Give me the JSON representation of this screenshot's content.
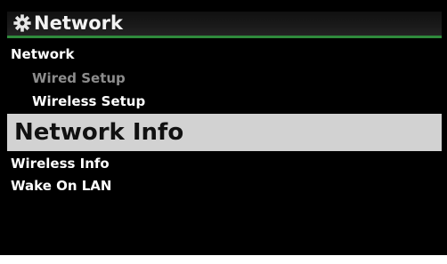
{
  "colors": {
    "background": "#000000",
    "title_accent": "#2f8a3c",
    "selected_bg": "#d2d2d2",
    "disabled_text": "#8c8c8c",
    "text": "#ffffff"
  },
  "header": {
    "icon": "gear-icon",
    "title": "Network"
  },
  "menu": {
    "items": [
      {
        "label": "Network",
        "level": 0,
        "state": "normal"
      },
      {
        "label": "Wired Setup",
        "level": 1,
        "state": "disabled"
      },
      {
        "label": "Wireless Setup",
        "level": 1,
        "state": "normal"
      },
      {
        "label": "Network Info",
        "level": 0,
        "state": "selected"
      },
      {
        "label": "Wireless Info",
        "level": 0,
        "state": "normal"
      },
      {
        "label": "Wake On LAN",
        "level": 0,
        "state": "normal"
      }
    ]
  }
}
